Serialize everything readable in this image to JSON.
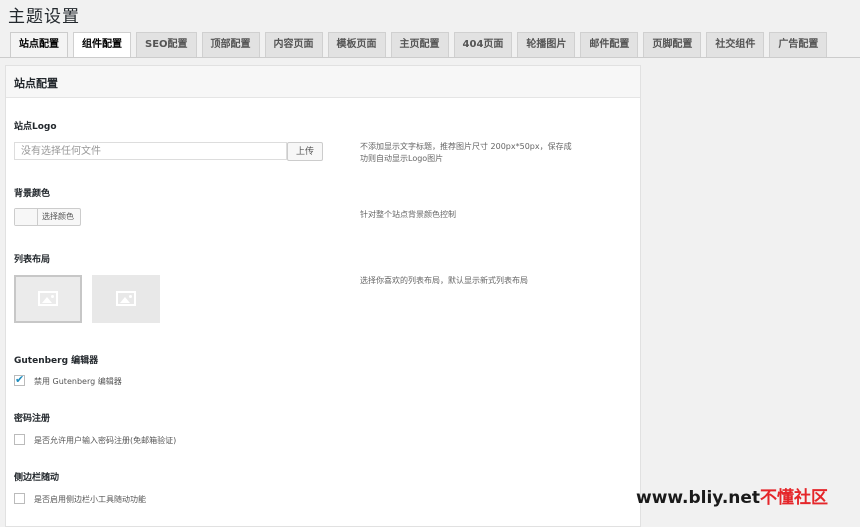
{
  "page": {
    "title": "主题设置"
  },
  "tabs": [
    {
      "label": "站点配置"
    },
    {
      "label": "组件配置"
    },
    {
      "label": "SEO配置"
    },
    {
      "label": "顶部配置"
    },
    {
      "label": "内容页面"
    },
    {
      "label": "模板页面"
    },
    {
      "label": "主页配置"
    },
    {
      "label": "404页面"
    },
    {
      "label": "轮播图片"
    },
    {
      "label": "邮件配置"
    },
    {
      "label": "页脚配置"
    },
    {
      "label": "社交组件"
    },
    {
      "label": "广告配置"
    }
  ],
  "panel": {
    "title": "站点配置"
  },
  "logo": {
    "label": "站点Logo",
    "placeholder": "没有选择任何文件",
    "upload_label": "上传",
    "desc_line1": "不添加显示文字标题，推荐图片尺寸 200px*50px，保存成",
    "desc_line2": "功则自动显示Logo图片"
  },
  "bg_color": {
    "label": "背景颜色",
    "button_label": "选择颜色",
    "desc": "针对整个站点背景颜色控制"
  },
  "list_layout": {
    "label": "列表布局",
    "desc": "选择你喜欢的列表布局，默认显示新式列表布局"
  },
  "gutenberg": {
    "label": "Gutenberg 编辑器",
    "option": "禁用 Gutenberg 编辑器",
    "checked": true
  },
  "password_reg": {
    "label": "密码注册",
    "option": "是否允许用户输入密码注册(免邮箱验证)",
    "checked": false
  },
  "sidebar_follow": {
    "label": "侧边栏随动",
    "option": "是否启用侧边栏小工具随动功能",
    "checked": false
  },
  "watermark": {
    "prefix": "www.bliy.net",
    "suffix": "不懂社区"
  }
}
